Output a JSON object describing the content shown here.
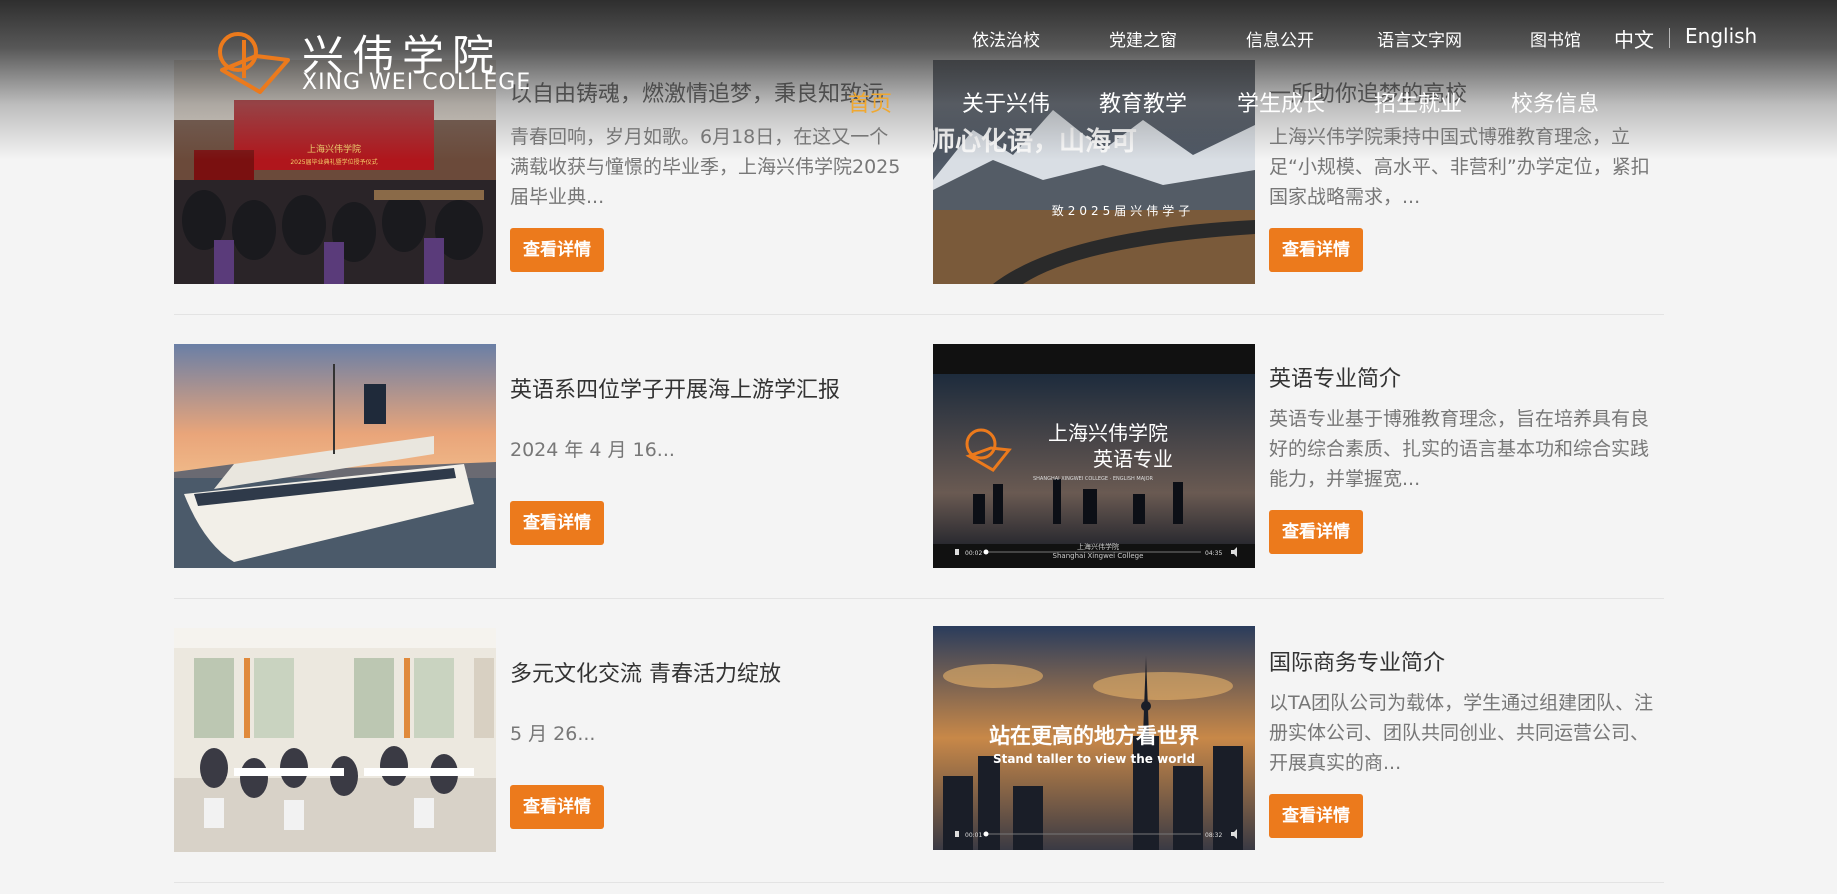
{
  "brand": {
    "name_cn": "兴伟学院",
    "name_en": "XING WEI COLLEGE",
    "accent": "#ec7a1c"
  },
  "top_links": [
    "依法治校",
    "党建之窗",
    "信息公开",
    "语言文字网",
    "图书馆"
  ],
  "languages": {
    "zh": "中文",
    "en": "English"
  },
  "main_nav": [
    "首页",
    "关于兴伟",
    "教育教学",
    "学生成长",
    "招生就业",
    "校务信息"
  ],
  "active_nav": "首页",
  "button_label": "查看详情",
  "news": [
    {
      "title": "以自由铸魂，燃激情追梦，秉良知致远",
      "summary": "青春回响，岁月如歌。6月18日，在这又一个满载收获与憧憬的毕业季，上海兴伟学院2025届毕业典...",
      "image": "graduation-ceremony-photo",
      "image_text": [
        "上海兴伟学院",
        "2025届毕业典礼暨学位授予仪式"
      ]
    },
    {
      "title": "一所助你追梦的高校",
      "summary": "上海兴伟学院秉持中国式博雅教育理念，立足“小规模、高水平、非营利”办学定位，紧扣国家战略需求，...",
      "image": "mountain-road-banner",
      "image_text": [
        "师心化语，山海可",
        "致2025届兴伟学子"
      ]
    },
    {
      "title": "英语系四位学子开展海上游学汇报",
      "summary": "2024 年 4 月 16...",
      "image": "cruise-ship-photo",
      "image_text": []
    },
    {
      "title": "英语专业简介",
      "summary": "英语专业基于博雅教育理念，旨在培养具有良好的综合素质、扎实的语言基本功和综合实践能力，并掌握宽...",
      "image": "english-major-video",
      "image_text": [
        "上海兴伟学院",
        "英语专业",
        "SHANGHAI XINGWEI COLLEGE · ENGLISH MAJOR",
        "上海兴伟学院",
        "Shanghai Xingwei College",
        "00:02",
        "04:35"
      ]
    },
    {
      "title": "多元文化交流 青春活力绽放",
      "summary": "5 月 26...",
      "image": "cafeteria-photo",
      "image_text": []
    },
    {
      "title": "国际商务专业简介",
      "summary": "以TA团队公司为载体，学生通过组建团队、注册实体公司、团队共同创业、共同运营公司、开展真实的商...",
      "image": "city-skyline-video",
      "image_text": [
        "站在更高的地方看世界",
        "Stand taller to view the world",
        "00:01",
        "08:32"
      ]
    }
  ]
}
